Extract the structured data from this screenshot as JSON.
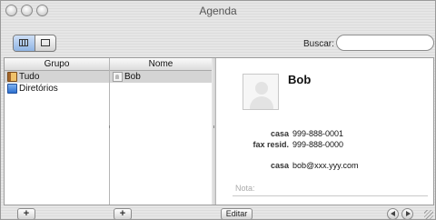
{
  "window": {
    "title": "Agenda"
  },
  "toolbar": {
    "search_label": "Buscar:",
    "search_value": "",
    "search_placeholder": ""
  },
  "groups": {
    "header": "Grupo",
    "items": [
      {
        "label": "Tudo",
        "icon": "address-book-icon",
        "selected": true
      },
      {
        "label": "Diretórios",
        "icon": "directory-icon",
        "selected": false
      }
    ]
  },
  "names": {
    "header": "Nome",
    "items": [
      {
        "label": "Bob",
        "icon": "vcard-icon",
        "selected": true
      }
    ]
  },
  "card": {
    "name": "Bob",
    "fields": [
      {
        "label": "casa",
        "value": "999-888-0001"
      },
      {
        "label": "fax resid.",
        "value": "999-888-0000"
      },
      {
        "label": "casa",
        "value": "bob@xxx.yyy.com"
      }
    ],
    "note_label": "Nota:"
  },
  "bottombar": {
    "add_label": "+",
    "edit_label": "Editar"
  },
  "colors": {
    "selection": "#d4d4d4",
    "accent": "#8fb4e4"
  }
}
